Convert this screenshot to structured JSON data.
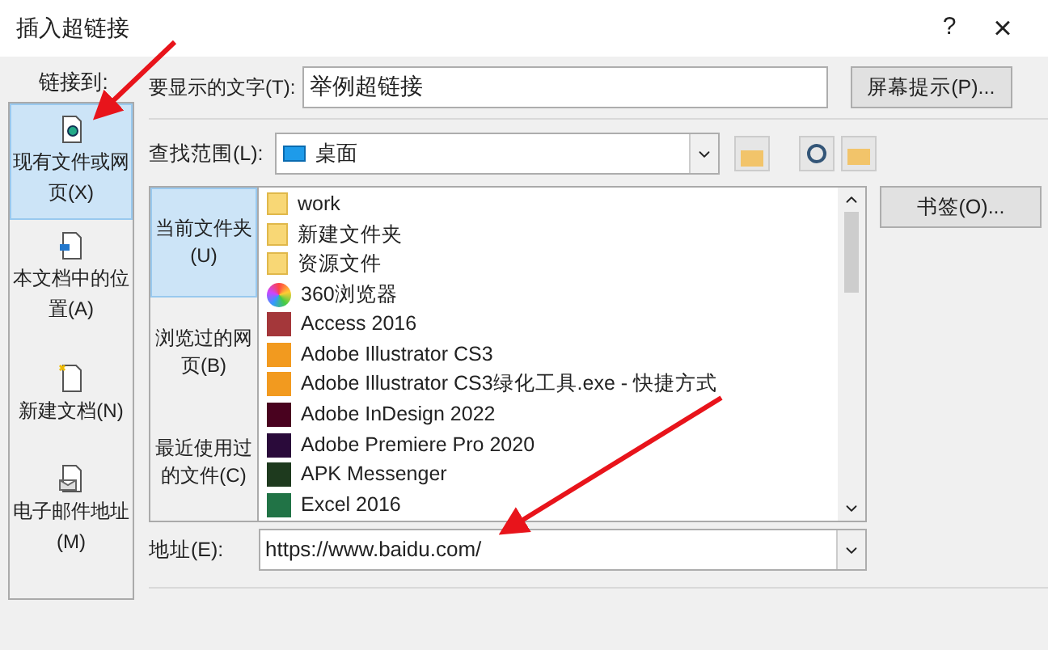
{
  "window": {
    "title": "插入超链接",
    "help": "?",
    "close": "×"
  },
  "link_to": {
    "label": "链接到:",
    "items": [
      {
        "label": "现有文件或网页(X)",
        "kind": "file",
        "selected": true
      },
      {
        "label": "本文档中的位置(A)",
        "kind": "place",
        "selected": false
      },
      {
        "label": "新建文档(N)",
        "kind": "new",
        "selected": false
      },
      {
        "label": "电子邮件地址(M)",
        "kind": "mail",
        "selected": false
      }
    ]
  },
  "display_text": {
    "label": "要显示的文字(T):",
    "value": "举例超链接"
  },
  "screentip_button": "屏幕提示(P)...",
  "look_in": {
    "label": "查找范围(L):",
    "value": "桌面"
  },
  "bookmark_button": "书签(O)...",
  "nav": [
    {
      "label": "当前文件夹(U)",
      "selected": true
    },
    {
      "label": "浏览过的网页(B)",
      "selected": false
    },
    {
      "label": "最近使用过的文件(C)",
      "selected": false
    }
  ],
  "files": [
    {
      "name": "work",
      "kind": "folder"
    },
    {
      "name": "新建文件夹",
      "kind": "folder"
    },
    {
      "name": "资源文件",
      "kind": "folder"
    },
    {
      "name": "360浏览器",
      "kind": "browser"
    },
    {
      "name": "Access 2016",
      "kind": "access"
    },
    {
      "name": "Adobe Illustrator CS3",
      "kind": "illustrator"
    },
    {
      "name": "Adobe Illustrator CS3绿化工具.exe - 快捷方式",
      "kind": "illustrator"
    },
    {
      "name": "Adobe InDesign 2022",
      "kind": "indesign"
    },
    {
      "name": "Adobe Premiere Pro 2020",
      "kind": "premiere"
    },
    {
      "name": "APK Messenger",
      "kind": "apk"
    },
    {
      "name": "Excel 2016",
      "kind": "excel"
    }
  ],
  "address": {
    "label": "地址(E):",
    "value": "https://www.baidu.com/"
  }
}
